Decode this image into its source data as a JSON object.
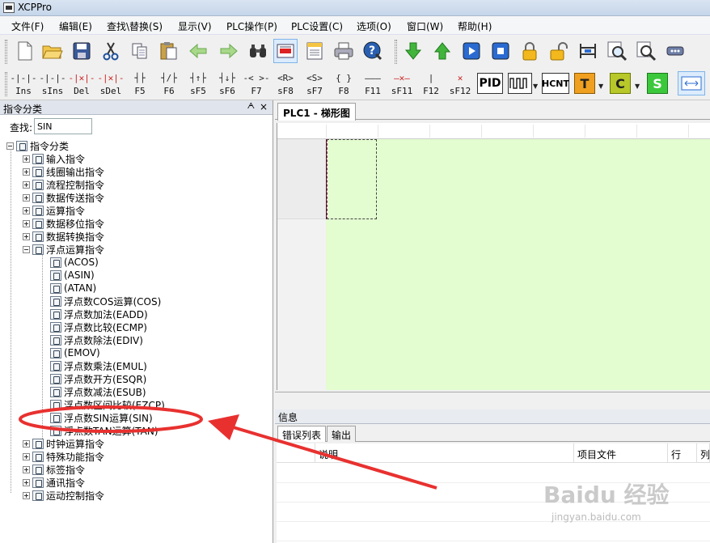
{
  "window": {
    "title": "XCPPro"
  },
  "menu": [
    "文件(F)",
    "编辑(E)",
    "查找\\替换(S)",
    "显示(V)",
    "PLC操作(P)",
    "PLC设置(C)",
    "选项(O)",
    "窗口(W)",
    "帮助(H)"
  ],
  "toolbar1_icons": [
    "new-file-icon",
    "open-folder-icon",
    "save-icon",
    "cut-icon",
    "copy-icon",
    "paste-icon",
    "back-arrow-icon",
    "forward-arrow-icon",
    "binoculars-icon",
    "ladder-view-icon",
    "instruction-list-icon",
    "print-icon",
    "help-icon",
    "download-icon",
    "upload-icon",
    "run-icon",
    "stop-icon",
    "lock-icon",
    "unlock-icon",
    "monitor-icon",
    "zoom-search-icon",
    "find-icon",
    "comm-icon"
  ],
  "toolbar2": {
    "buttons": [
      {
        "sym": "‐|‐|‐",
        "label": "Ins"
      },
      {
        "sym": "‐|‐|‐",
        "label": "sIns"
      },
      {
        "sym": "‐|✕|‐",
        "label": "Del"
      },
      {
        "sym": "‐|✕|‐",
        "label": "sDel"
      },
      {
        "sym": "┤├",
        "label": "F5"
      },
      {
        "sym": "┤/├",
        "label": "F6"
      },
      {
        "sym": "┤↑├",
        "label": "sF5"
      },
      {
        "sym": "┤↓├",
        "label": "sF6"
      },
      {
        "sym": "‐< >‐",
        "label": "F7"
      },
      {
        "sym": "<R>",
        "label": "sF8"
      },
      {
        "sym": "<S>",
        "label": "sF7"
      },
      {
        "sym": "{ }",
        "label": "F8"
      },
      {
        "sym": "———",
        "label": "F11"
      },
      {
        "sym": "—✕—",
        "label": "sF11"
      },
      {
        "sym": "|",
        "label": "F12"
      },
      {
        "sym": "✕",
        "label": "sF12"
      }
    ],
    "pid": "PID",
    "hcnt": "HCNT",
    "t": "T",
    "c": "C",
    "s": "S"
  },
  "left_panel": {
    "title": "指令分类",
    "pin": "ᗅ",
    "close": "×",
    "search_label": "查找:",
    "search_value": "SIN",
    "tree": {
      "root": "指令分类",
      "groups_top": [
        "输入指令",
        "线圈输出指令",
        "流程控制指令",
        "数据传送指令",
        "运算指令",
        "数据移位指令",
        "数据转换指令"
      ],
      "expanded_group": "浮点运算指令",
      "children": [
        "(ACOS)",
        "(ASIN)",
        "(ATAN)",
        "浮点数COS运算(COS)",
        "浮点数加法(EADD)",
        "浮点数比较(ECMP)",
        "浮点数除法(EDIV)",
        "(EMOV)",
        "浮点数乘法(EMUL)",
        "浮点数开方(ESQR)",
        "浮点数减法(ESUB)",
        "浮点数区间比较(EZCP)",
        "浮点数SIN运算(SIN)",
        "浮点数TAN运算(TAN)"
      ],
      "groups_bottom": [
        "时钟运算指令",
        "特殊功能指令",
        "标签指令",
        "通讯指令",
        "运动控制指令"
      ]
    }
  },
  "doc_tab": "PLC1 - 梯形图",
  "info_panel": {
    "title": "信息",
    "tabs": [
      "错误列表",
      "输出"
    ],
    "columns": [
      "",
      "说明",
      "项目文件",
      "行",
      "列"
    ]
  },
  "watermark": {
    "main": "Baidu 经验",
    "sub": "jingyan.baidu.com"
  },
  "colors": {
    "ladder_bg": "#e3fcd0",
    "annotation_red": "#e8312f"
  }
}
